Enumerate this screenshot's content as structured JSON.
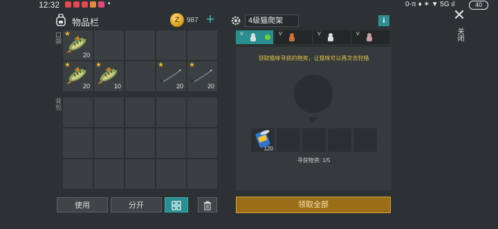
{
  "status": {
    "time": "12:32",
    "right_text": "0-π ♦ ✶ ▼ 5G ıl",
    "battery": "40"
  },
  "inventory": {
    "title": "物品栏",
    "coins": "987",
    "pocket_label": "口袋",
    "backpack_label": "背包",
    "pocket_slots": [
      {
        "item": "perch-fish",
        "starred": true,
        "count": "20"
      },
      {
        "item": "",
        "starred": false,
        "count": ""
      },
      {
        "item": "",
        "starred": false,
        "count": ""
      },
      {
        "item": "",
        "starred": false,
        "count": ""
      },
      {
        "item": "",
        "starred": false,
        "count": ""
      },
      {
        "item": "perch-fish",
        "starred": true,
        "count": "20"
      },
      {
        "item": "perch-fish",
        "starred": true,
        "count": "10"
      },
      {
        "item": "",
        "starred": false,
        "count": ""
      },
      {
        "item": "sturgeon-fish",
        "starred": true,
        "count": "20"
      },
      {
        "item": "sturgeon-fish",
        "starred": true,
        "count": "20"
      }
    ],
    "buttons": {
      "use": "使用",
      "split": "分开"
    }
  },
  "trap": {
    "title": "4级猫爬架",
    "tabs": [
      {
        "level": "V",
        "active": true
      },
      {
        "level": "V",
        "active": false
      },
      {
        "level": "V",
        "active": false
      },
      {
        "level": "V",
        "active": false
      }
    ],
    "hint": "领取猫咪寻获的物资，让猫咪可以再次去狩猎",
    "loot": [
      {
        "item": "canned-food",
        "count": "120"
      }
    ],
    "loot_count_text": "寻获物资: 1/5",
    "collect_all": "领取全部"
  },
  "close_label": "关闭",
  "colors": {
    "accent": "#2a8d90",
    "collect_button": "#9a6d18",
    "hint": "#e6c44a",
    "star": "#f1b92c"
  }
}
